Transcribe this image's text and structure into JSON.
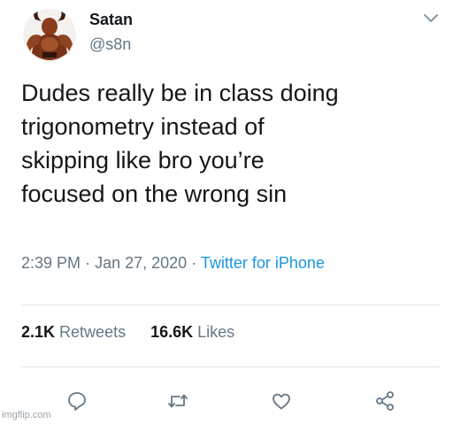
{
  "user": {
    "display_name": "Satan",
    "handle": "@s8n"
  },
  "tweet": {
    "lines": [
      "Dudes really be in class doing",
      "trigonometry instead of",
      "skipping like bro you’re",
      "focused on the wrong sin"
    ],
    "time": "2:39 PM",
    "date": "Jan 27, 2020",
    "separator": "·",
    "source": "Twitter for iPhone"
  },
  "stats": {
    "retweets_count": "2.1K",
    "retweets_label": "Retweets",
    "likes_count": "16.6K",
    "likes_label": "Likes"
  },
  "actions": {
    "icons": [
      "reply-icon",
      "retweet-icon",
      "like-icon",
      "share-icon"
    ]
  },
  "colors": {
    "text_primary": "#14171a",
    "text_secondary": "#657786",
    "link": "#1b95e0",
    "divider": "#e1e8ed"
  },
  "watermark": "imgflip.com"
}
